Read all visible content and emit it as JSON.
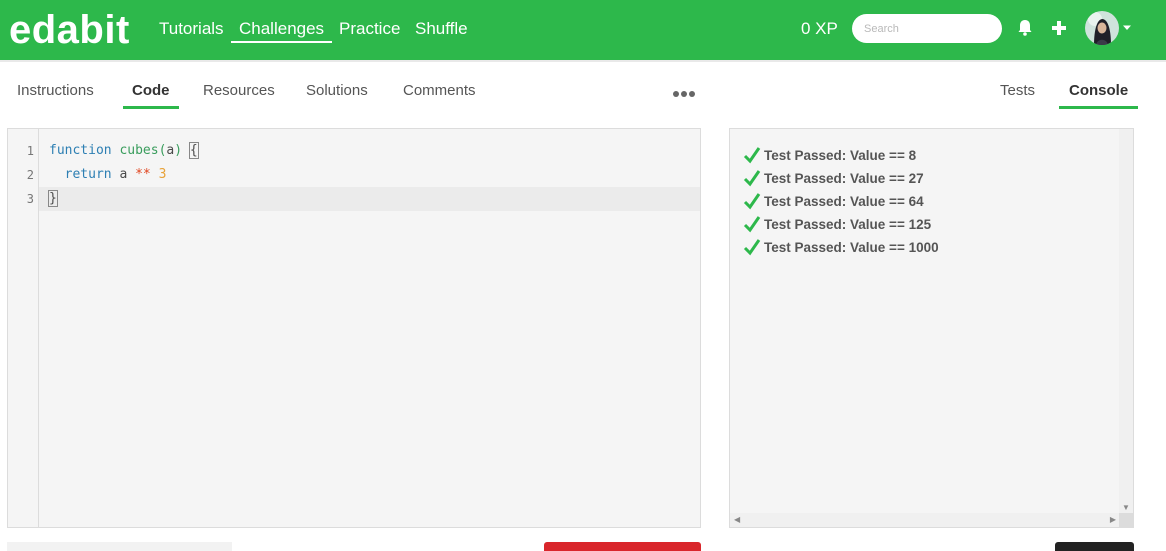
{
  "header": {
    "logo": "edabit",
    "nav": [
      "Tutorials",
      "Challenges",
      "Practice",
      "Shuffle"
    ],
    "active_nav": "Challenges",
    "xp": "0 XP",
    "search_placeholder": "Search",
    "icons": [
      "bell-icon",
      "plus-icon",
      "avatar",
      "chevron-down-icon"
    ],
    "bg_color": "#2db84b"
  },
  "tabs": {
    "left": [
      "Instructions",
      "Code",
      "Resources",
      "Solutions",
      "Comments"
    ],
    "left_active": "Code",
    "right": [
      "Tests",
      "Console"
    ],
    "right_active": "Console"
  },
  "editor": {
    "line_numbers": [
      "1",
      "2",
      "3"
    ],
    "lines": {
      "l1": {
        "kw": "function",
        "name": "cubes",
        "open": "(",
        "param": "a",
        "close": ")",
        "brace": "{"
      },
      "l2": {
        "kw": "return",
        "var": "a",
        "op": "**",
        "num": "3"
      },
      "l3": {
        "brace": "}"
      }
    }
  },
  "console": {
    "results": [
      "Test Passed: Value == 8",
      "Test Passed: Value == 27",
      "Test Passed: Value == 64",
      "Test Passed: Value == 125",
      "Test Passed: Value == 1000"
    ],
    "pass_color": "#2db84b"
  }
}
